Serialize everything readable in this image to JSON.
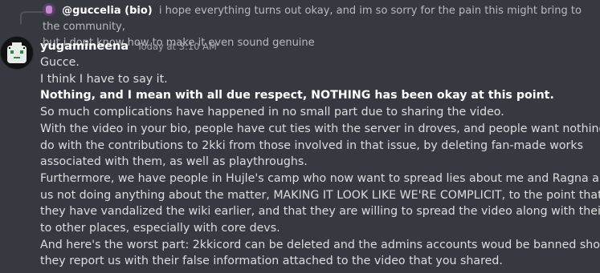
{
  "reply": {
    "username": "@guccelia (bio)",
    "line1": "i hope everything turns out okay, and im so sorry for the pain this might bring to the community,",
    "line2": "but i dont know how to make it even sound genuine"
  },
  "message": {
    "username": "yugamineena",
    "timestamp": "Today at 3:10 AM",
    "lines": [
      "Gucce.",
      "I think I have to say it.",
      "Nothing, and I mean with all due respect, NOTHING has been okay at this point.",
      "So much complications have happened in no small part due to sharing the video.",
      "With the video in your bio, people have cut ties with the server in droves, and people want nothing to",
      "do with the contributions to 2kki from those involved in that issue, by deleting fan-made works",
      "associated with them, as well as playthroughs.",
      "Furthermore, we have people in Hujle's camp who now want to spread lies about me and Ragna about",
      "us not doing anything about the matter, MAKING IT LOOK LIKE WE'RE COMPLICIT, to the point that",
      "they have vandalized the wiki earlier, and that they are willing to spread the video along with their lies",
      "to other places, especially with core devs.",
      "And here's the worst part: 2kkicord can be deleted and the admins accounts woud be banned should",
      "they report us with their false information attached to the video that you shared."
    ]
  }
}
